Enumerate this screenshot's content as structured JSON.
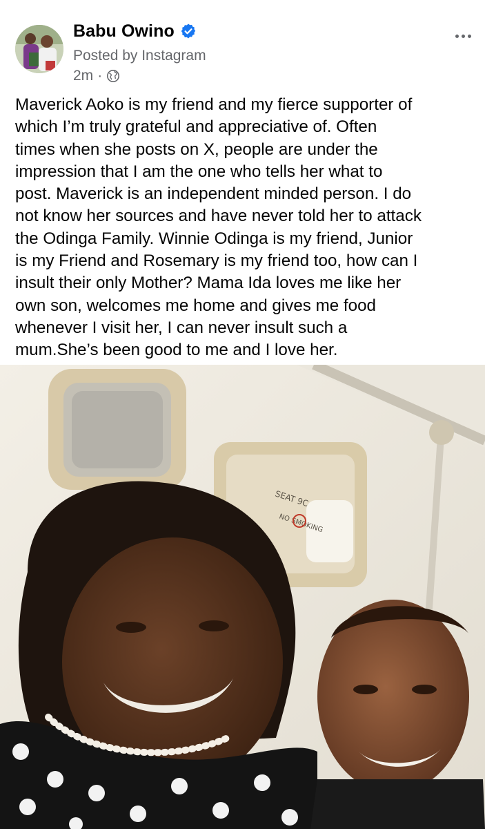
{
  "post": {
    "author": {
      "name": "Babu Owino",
      "verified": true,
      "avatar_icon": "profile-photo-avatar"
    },
    "posted_by": "Posted by Instagram",
    "timestamp": "2m",
    "separator": "·",
    "audience_icon": "globe-icon",
    "menu_icon": "more-options-icon",
    "text": "Maverick Aoko is my friend and my fierce supporter of\nwhich I’m truly grateful and appreciative of. Often\ntimes when she posts on X, people are under the\nimpression that I am the one who tells her what to\npost. Maverick is an independent minded person. I do\nnot know her sources and have never told her to attack\nthe Odinga Family. Winnie Odinga is my friend, Junior\nis my Friend and Rosemary is my friend too, how can I\ninsult their only Mother? Mama Ida loves me like her\nown son, welcomes me home and gives me food\nwhenever I visit her, I can never insult such a\nmum.She’s been good to me and I love her.",
    "photo": {
      "sign_text": "SEAT 9C",
      "sign_subtext": "NO SMOKING"
    }
  },
  "colors": {
    "name": "#050505",
    "secondary": "#65676b",
    "verified": "#1877f2",
    "background": "#ffffff"
  }
}
